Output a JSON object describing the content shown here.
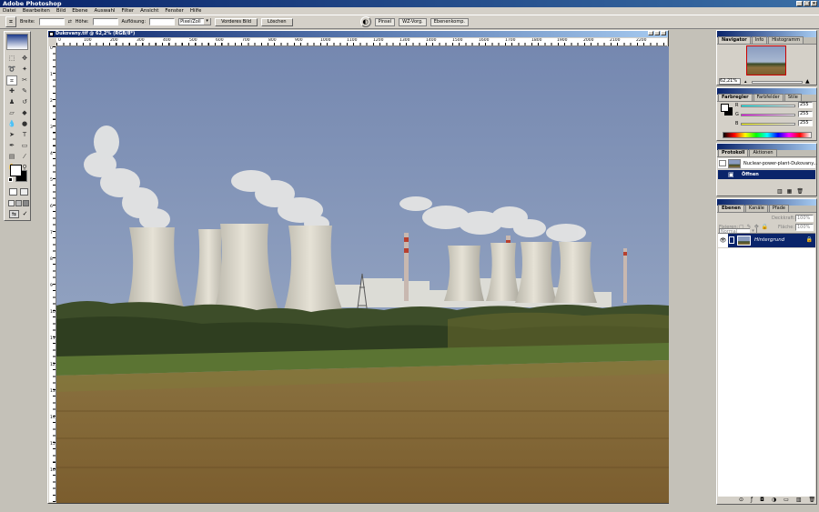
{
  "app": {
    "title": "Adobe Photoshop"
  },
  "menu": [
    "Datei",
    "Bearbeiten",
    "Bild",
    "Ebene",
    "Auswahl",
    "Filter",
    "Ansicht",
    "Fenster",
    "Hilfe"
  ],
  "options": {
    "width_label": "Breite:",
    "height_label": "Höhe:",
    "resolution_label": "Auflösung:",
    "unit_value": "Pixel/Zoll",
    "front_image_button": "Vorderes Bild",
    "clear_button": "Löschen",
    "palette_tabs": [
      "Pinsel",
      "WZ-Vorg.",
      "Ebenenkomp."
    ]
  },
  "document": {
    "title": "Dukovany.tif @ 62,2% (RGB/8*)",
    "hruler": [
      "0",
      "100",
      "200",
      "300",
      "400",
      "500",
      "600",
      "700",
      "800",
      "900",
      "1000",
      "1100",
      "1200",
      "1300",
      "1400",
      "1500",
      "1600",
      "1700",
      "1800",
      "1900",
      "2000",
      "2100",
      "2200"
    ],
    "vruler": [
      "0",
      "1",
      "2",
      "3",
      "4",
      "5",
      "6",
      "7",
      "8",
      "9",
      "10",
      "11",
      "12",
      "13",
      "14",
      "15",
      "16"
    ]
  },
  "navigator": {
    "tabs": [
      "Navigator",
      "Info",
      "Histogramm"
    ],
    "zoom": "62,21%"
  },
  "color": {
    "tabs": [
      "Farbregler",
      "Farbfelder",
      "Stile"
    ],
    "channels": [
      {
        "label": "R",
        "value": "255",
        "color": "#ff0000"
      },
      {
        "label": "G",
        "value": "255",
        "color": "#00c000"
      },
      {
        "label": "B",
        "value": "255",
        "color": "#0000ff"
      }
    ]
  },
  "history": {
    "tabs": [
      "Protokoll",
      "Aktionen"
    ],
    "snapshot": "Nuclear-power-plant-Dukovany...",
    "step": "Öffnen"
  },
  "layers": {
    "tabs": [
      "Ebenen",
      "Kanäle",
      "Pfade"
    ],
    "blend_mode": "Normal",
    "opacity_label": "Deckkraft:",
    "opacity_value": "100%",
    "lock_label": "Fixieren:",
    "fill_label": "Fläche:",
    "fill_value": "100%",
    "layer_name": "Hintergrund"
  },
  "colors": {
    "title_blue": "#0a246a",
    "chrome": "#d4d0c8"
  }
}
